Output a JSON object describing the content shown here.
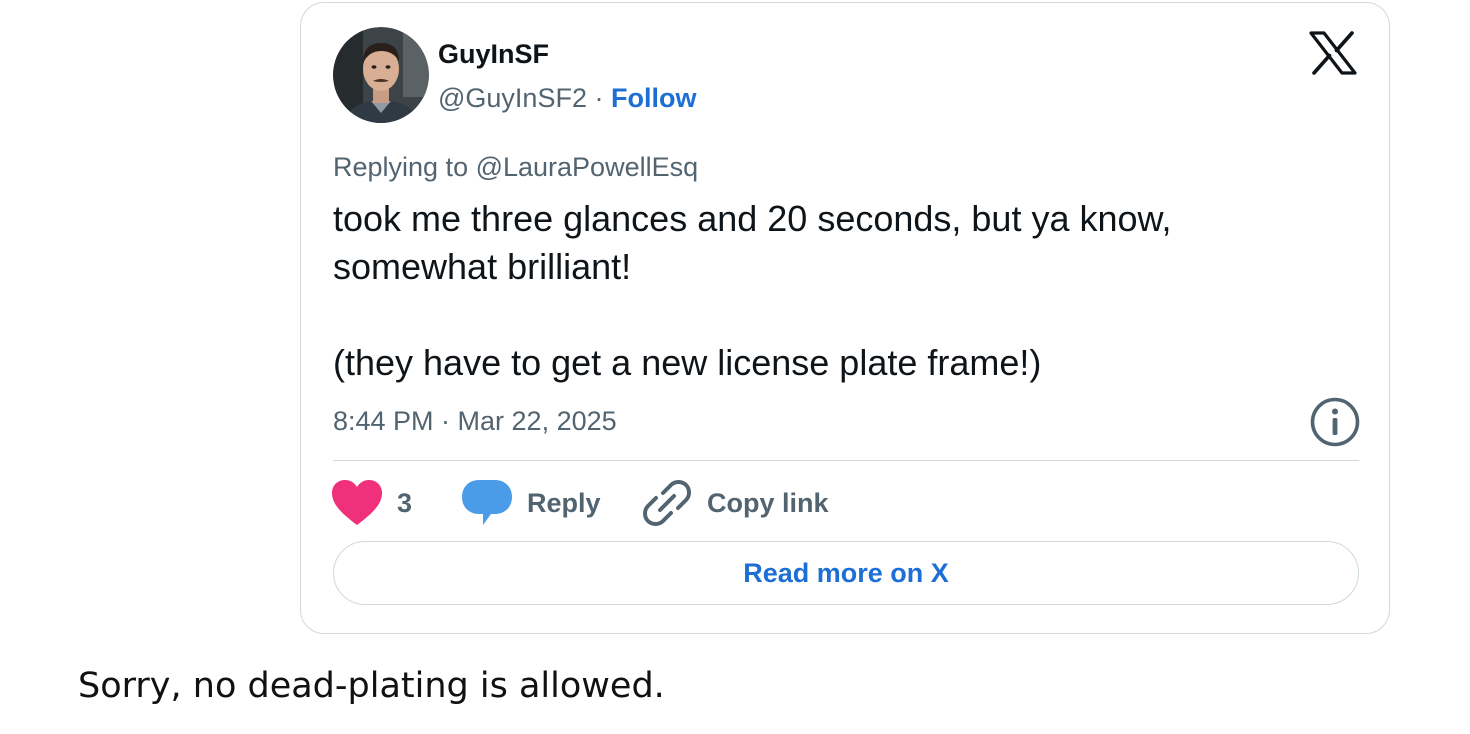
{
  "tweet": {
    "author": {
      "display_name": "GuyInSF",
      "handle": "@GuyInSF2",
      "separator": " · ",
      "follow_label": "Follow"
    },
    "reply_context": "Replying to @LauraPowellEsq",
    "text_paragraphs": [
      "took me three glances and 20 seconds, but ya know, somewhat brilliant!",
      "(they have to get a new license plate frame!)"
    ],
    "timestamp": "8:44 PM · Mar 22, 2025",
    "actions": {
      "like_count": "3",
      "reply_label": "Reply",
      "copy_link_label": "Copy link"
    },
    "read_more_label": "Read more on X",
    "icons": {
      "platform": "x-logo-icon",
      "info": "info-icon",
      "like": "heart-icon",
      "reply": "speech-bubble-icon",
      "copy": "link-icon"
    },
    "colors": {
      "accent": "#1d6fd6",
      "like": "#f91880",
      "reply": "#1d9bf0",
      "muted": "#536471",
      "border": "#cfd9de"
    }
  },
  "caption": "Sorry, no dead-plating is allowed."
}
